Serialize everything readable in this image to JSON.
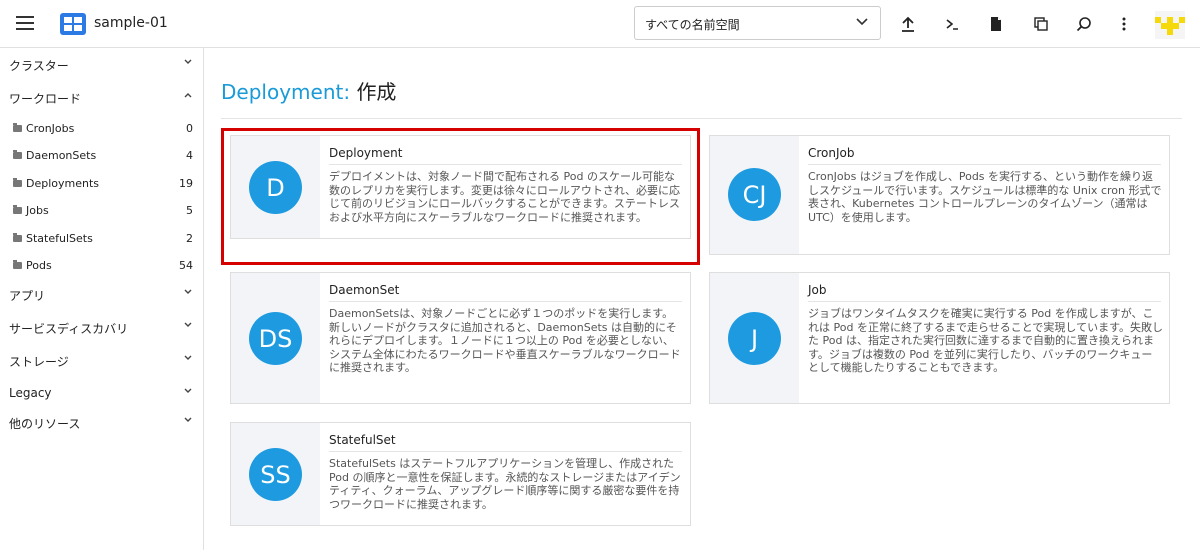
{
  "header": {
    "cluster_name": "sample-01",
    "namespace_selector": "すべての名前空間",
    "tools": [
      "upload-icon",
      "terminal-icon",
      "file-icon",
      "copy-icon",
      "search-icon",
      "more-icon"
    ]
  },
  "sidebar": {
    "groups": [
      {
        "label": "クラスター"
      },
      {
        "label": "ワークロード"
      },
      {
        "label": "アプリ"
      },
      {
        "label": "サービスディスカバリ"
      },
      {
        "label": "ストレージ"
      },
      {
        "label": "Legacy"
      },
      {
        "label": "他のリソース"
      }
    ],
    "items": [
      {
        "label": "CronJobs",
        "count": "0"
      },
      {
        "label": "DaemonSets",
        "count": "4"
      },
      {
        "label": "Deployments",
        "count": "19"
      },
      {
        "label": "Jobs",
        "count": "5"
      },
      {
        "label": "StatefulSets",
        "count": "2"
      },
      {
        "label": "Pods",
        "count": "54"
      }
    ]
  },
  "main": {
    "title_kind": "Deployment:",
    "title_action": "作成",
    "cards": [
      {
        "abbr": "D",
        "name": "Deployment",
        "description": "デプロイメントは、対象ノード間で配布される Pod のスケール可能な数のレプリカを実行します。変更は徐々にロールアウトされ、必要に応じて前のリビジョンにロールバックすることができます。ステートレスおよび水平方向にスケーラブルなワークロードに推奨されます。"
      },
      {
        "abbr": "CJ",
        "name": "CronJob",
        "description": "CronJobs はジョブを作成し、Pods を実行する、という動作を繰り返しスケジュールで行います。スケジュールは標準的な Unix cron 形式で表され、Kubernetes コントロールプレーンのタイムゾーン（通常は UTC）を使用します。"
      },
      {
        "abbr": "DS",
        "name": "DaemonSet",
        "description": "DaemonSetsは、対象ノードごとに必ず１つのポッドを実行します。新しいノードがクラスタに追加されると、DaemonSets は自動的にそれらにデプロイします。１ノードに１つ以上の Pod を必要としない、システム全体にわたるワークロードや垂直スケーラブルなワークロードに推奨されます。"
      },
      {
        "abbr": "J",
        "name": "Job",
        "description": "ジョブはワンタイムタスクを確実に実行する Pod を作成しますが、これは Pod を正常に終了するまで走らせることで実現しています。失敗した Pod は、指定された実行回数に達するまで自動的に置き換えられます。ジョブは複数の Pod を並列に実行したり、バッチのワークキューとして機能したりすることもできます。"
      },
      {
        "abbr": "SS",
        "name": "StatefulSet",
        "description": "StatefulSets はステートフルアプリケーションを管理し、作成された Pod の順序と一意性を保証します。永続的なストレージまたはアイデンティティ、クォーラム、アップグレード順序等に関する厳密な要件を持つワークロードに推奨されます。"
      }
    ]
  },
  "colors": {
    "accent": "#1e9be0",
    "title_kind": "#1a9bd7",
    "highlight": "#d50000",
    "avatar": "#f5d90a"
  }
}
